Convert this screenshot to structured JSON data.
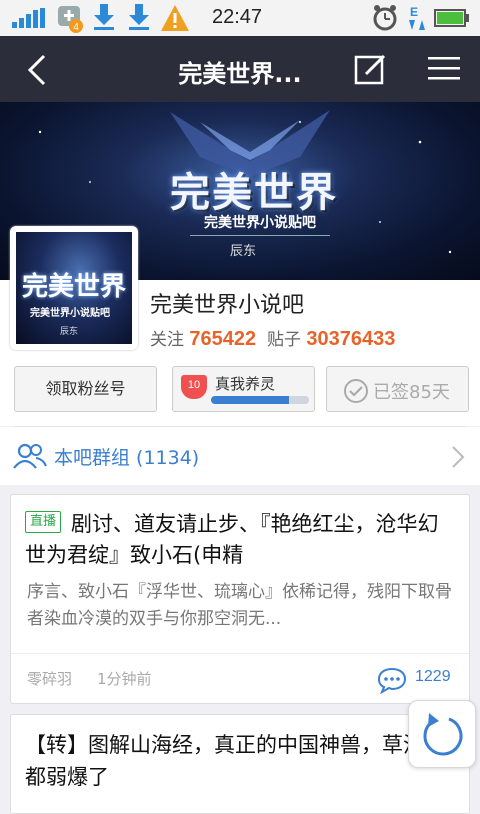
{
  "status_bar": {
    "time": "22:47",
    "notification_badge": "4",
    "icons": [
      "signal-icon",
      "notification-icon",
      "download-icon",
      "download-icon",
      "warning-icon",
      "alarm-icon",
      "network-icon",
      "battery-icon"
    ]
  },
  "nav": {
    "title": "完美世界...",
    "icons": [
      "back-icon",
      "edit-icon",
      "menu-icon"
    ]
  },
  "banner": {
    "title": "完美世界",
    "subtitle": "完美世界小说贴吧",
    "author": "辰东"
  },
  "forum": {
    "name": "完美世界小说吧",
    "follow_label": "关注",
    "follow_count": "765422",
    "posts_label": "贴子",
    "posts_count": "30376433"
  },
  "actions": {
    "fans_button": "领取粉丝号",
    "level": "10",
    "level_name": "真我养灵",
    "level_progress_percent": 80,
    "signed_label": "已签85天"
  },
  "group": {
    "label": "本吧群组 (1134)"
  },
  "posts": [
    {
      "tag": "直播",
      "title": "剧讨、道友请止步、『艳绝红尘，沧华幻世为君绽』致小石(申精",
      "abstract": "序言、致小石『浮华世、琉璃心』依稀记得，残阳下取骨者染血冷漠的双手与你那空洞无...",
      "author": "零碎羽",
      "time": "1分钟前",
      "comments": "1229"
    },
    {
      "title": "【转】图解山海经，真正的中国神兽，草泥马都弱爆了"
    }
  ],
  "colors": {
    "nav_bg": "#2b2e3a",
    "accent_blue": "#3a7fd0",
    "count_orange": "#e8632a",
    "live_tag_green": "#2aa84a"
  }
}
